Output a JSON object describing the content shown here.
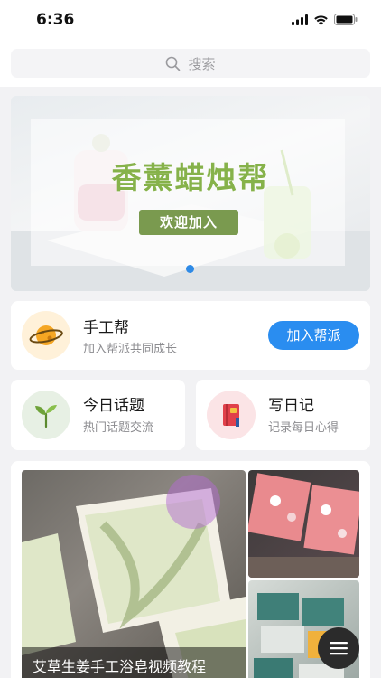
{
  "status": {
    "time": "6:36"
  },
  "search": {
    "placeholder": "搜索"
  },
  "banner": {
    "title": "香薰蜡烛帮",
    "button": "欢迎加入",
    "active_dot": 1,
    "dots": 2
  },
  "group": {
    "name": "手工帮",
    "subtitle": "加入帮派共同成长",
    "join_label": "加入帮派"
  },
  "shortcuts": [
    {
      "title": "今日话题",
      "subtitle": "热门话题交流",
      "icon": "sprout-icon"
    },
    {
      "title": "写日记",
      "subtitle": "记录每日心得",
      "icon": "notebook-icon"
    }
  ],
  "gallery": {
    "caption": "艾草生姜手工浴皂视频教程"
  },
  "colors": {
    "accent": "#2a8df0",
    "banner_title": "#86b24a",
    "banner_button": "#7a9a4f"
  }
}
